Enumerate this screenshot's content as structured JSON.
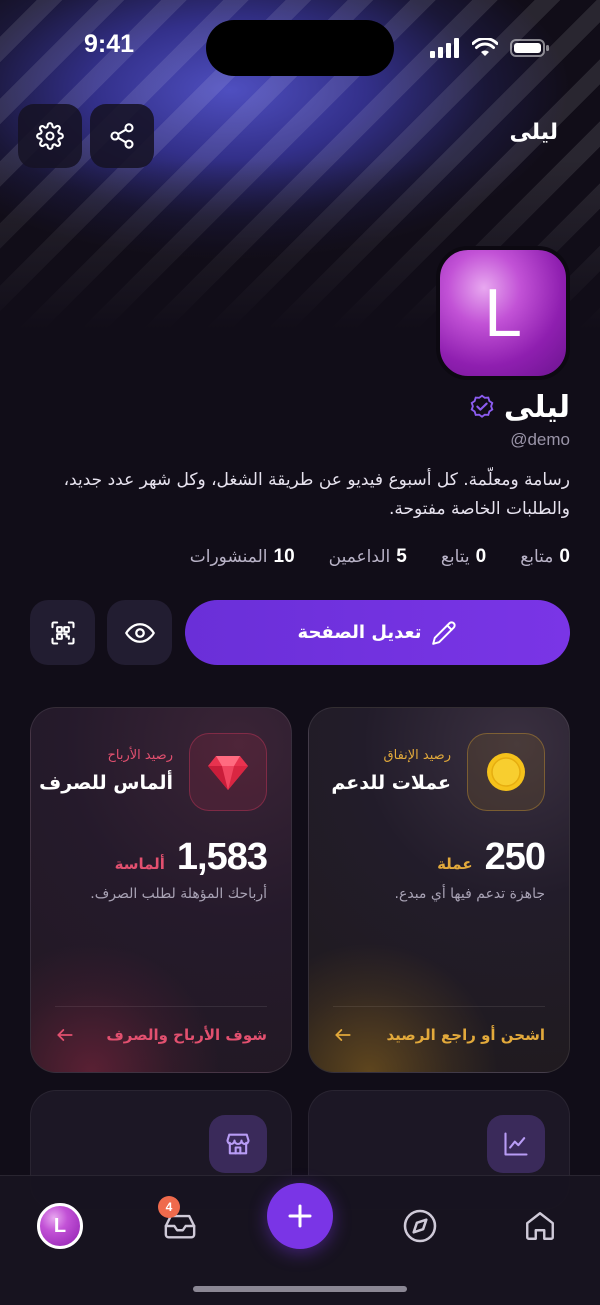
{
  "status_bar": {
    "time": "9:41"
  },
  "header": {
    "name": "ليلى"
  },
  "profile": {
    "avatar_letter": "L",
    "name": "ليلى",
    "handle": "@demo",
    "bio": "رسامة ومعلّمة. كل أسبوع فيديو عن طريقة الشغل، وكل شهر عدد جديد، والطلبات الخاصة مفتوحة."
  },
  "stats": [
    {
      "value": "0",
      "label": "متابع"
    },
    {
      "value": "0",
      "label": "يتابع"
    },
    {
      "value": "5",
      "label": "الداعمين"
    },
    {
      "value": "10",
      "label": "المنشورات"
    }
  ],
  "actions": {
    "edit_label": "تعديل الصفحة"
  },
  "cards": {
    "coins": {
      "kicker": "رصيد الإنفاق",
      "title": "عملات للدعم",
      "amount": "250",
      "unit": "عملة",
      "desc": "جاهزة تدعم فيها أي مبدع.",
      "link": "اشحن أو راجع الرصيد",
      "accent": "#e2a93b"
    },
    "diamonds": {
      "kicker": "رصيد الأرباح",
      "title": "ألماس للصرف",
      "amount": "1,583",
      "unit": "ألماسة",
      "desc": "أرباحك المؤهلة لطلب الصرف.",
      "link": "شوف الأرباح والصرف",
      "accent": "#e2506f"
    }
  },
  "tabbar": {
    "avatar_letter": "L",
    "inbox_badge": "4",
    "brand_color": "#7a35e6"
  }
}
